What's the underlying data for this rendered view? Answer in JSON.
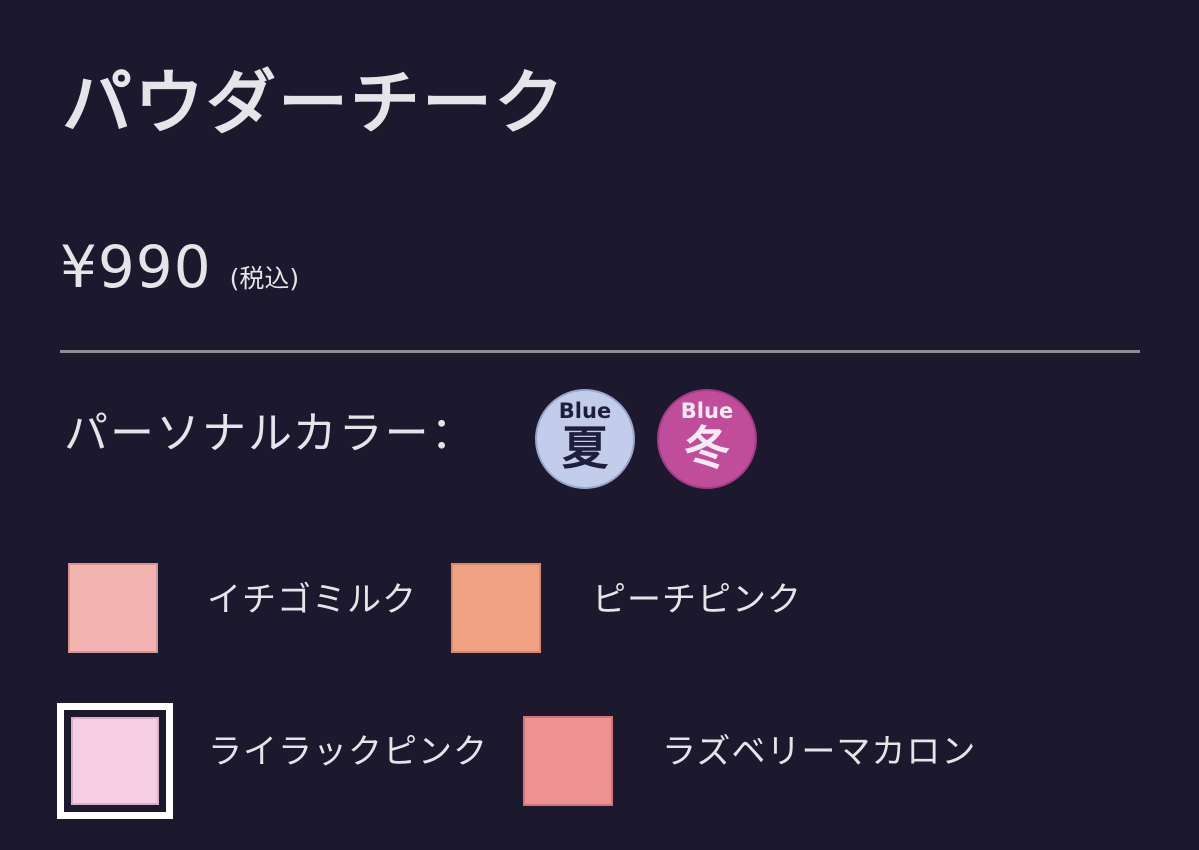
{
  "product": {
    "title": "パウダーチーク",
    "price": "¥990",
    "tax_note": "(税込)"
  },
  "personal_color": {
    "label": "パーソナルカラー：",
    "badges": [
      {
        "top": "Blue",
        "main": "夏",
        "bg": "#c3cdeb",
        "fg": "#1e1f3c"
      },
      {
        "top": "Blue",
        "main": "冬",
        "bg": "#c04d9c",
        "fg": "#f6eaf3"
      }
    ]
  },
  "swatches": [
    {
      "name": "イチゴミルク",
      "color": "#f2b3b1",
      "selected": false
    },
    {
      "name": "ピーチピンク",
      "color": "#f0a083",
      "selected": false
    },
    {
      "name": "ライラックピンク",
      "color": "#f7cde3",
      "selected": true
    },
    {
      "name": "ラズベリーマカロン",
      "color": "#ef9190",
      "selected": false
    }
  ]
}
